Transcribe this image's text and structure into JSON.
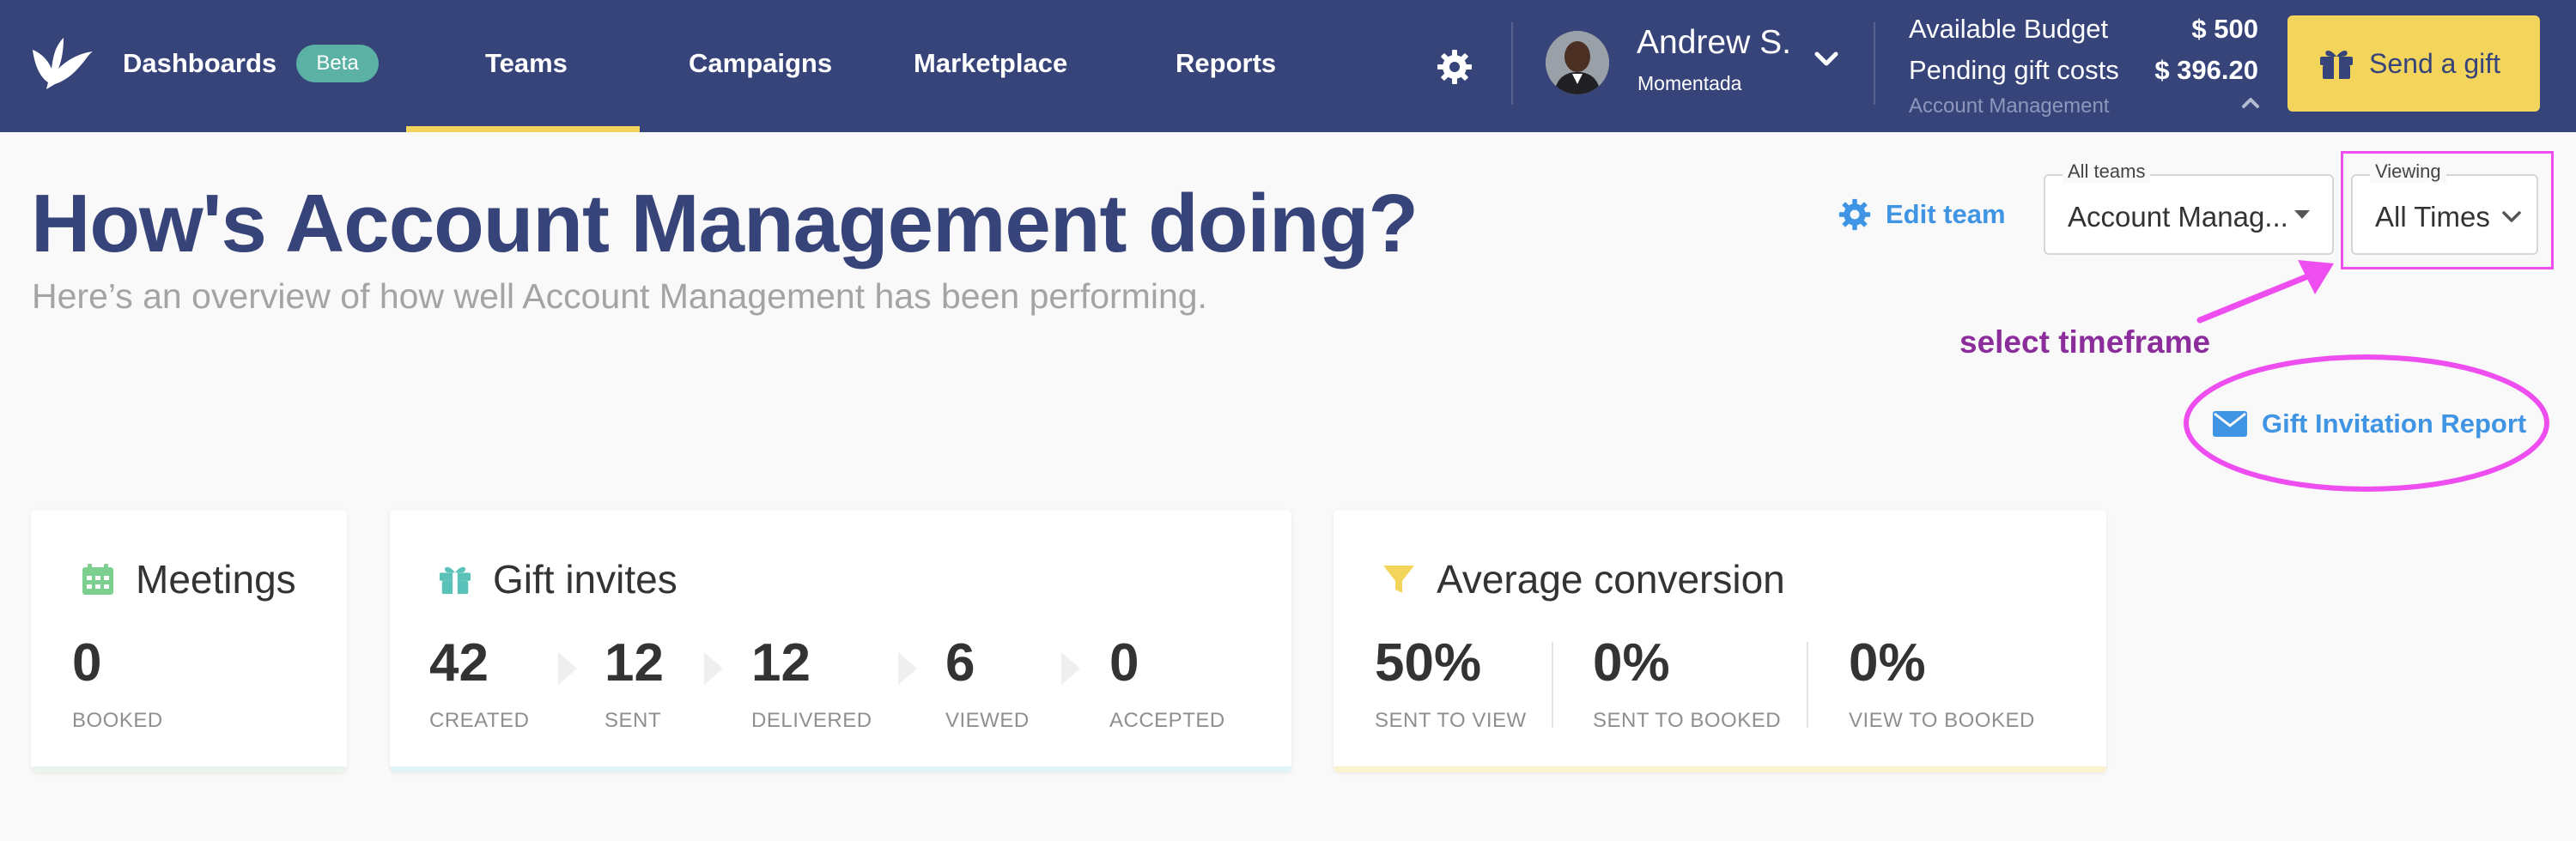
{
  "nav": {
    "items": [
      {
        "label": "Dashboards"
      },
      {
        "label": "Teams"
      },
      {
        "label": "Campaigns"
      },
      {
        "label": "Marketplace"
      },
      {
        "label": "Reports"
      }
    ],
    "beta_badge": "Beta",
    "active_tab": "Teams",
    "user": {
      "name": "Andrew S.",
      "org": "Momentada"
    },
    "budget": {
      "available_label": "Available Budget",
      "available_value": "$ 500",
      "pending_label": "Pending gift costs",
      "pending_value": "$ 396.20",
      "team_label": "Account Management"
    },
    "send_gift_label": "Send a gift",
    "colors": {
      "nav_bg": "#37447a",
      "accent_yellow": "#f3d55b"
    }
  },
  "header": {
    "title": "How's Account Management doing?",
    "subtitle": "Here’s an overview of how well Account Management has been performing.",
    "edit_team_label": "Edit team",
    "team_select": {
      "legend": "All teams",
      "value": "Account Manag..."
    },
    "view_select": {
      "legend": "Viewing",
      "value": "All Times"
    },
    "report_link_label": "Gift Invitation Report"
  },
  "annotations": {
    "select_timeframe": "select timeframe",
    "color": "#ee4ef0"
  },
  "cards": {
    "meetings": {
      "title": "Meetings",
      "metrics": [
        {
          "value": "0",
          "label": "BOOKED"
        }
      ],
      "bar_color": "#e9f5ec"
    },
    "gift_invites": {
      "title": "Gift invites",
      "metrics": [
        {
          "value": "42",
          "label": "CREATED"
        },
        {
          "value": "12",
          "label": "SENT"
        },
        {
          "value": "12",
          "label": "DELIVERED"
        },
        {
          "value": "6",
          "label": "VIEWED"
        },
        {
          "value": "0",
          "label": "ACCEPTED"
        }
      ],
      "bar_color": "#e2f4f3"
    },
    "average_conversion": {
      "title": "Average conversion",
      "metrics": [
        {
          "value": "50%",
          "label": "SENT TO VIEW"
        },
        {
          "value": "0%",
          "label": "SENT TO BOOKED"
        },
        {
          "value": "0%",
          "label": "VIEW TO BOOKED"
        }
      ],
      "bar_color": "#fbf3cf"
    }
  }
}
